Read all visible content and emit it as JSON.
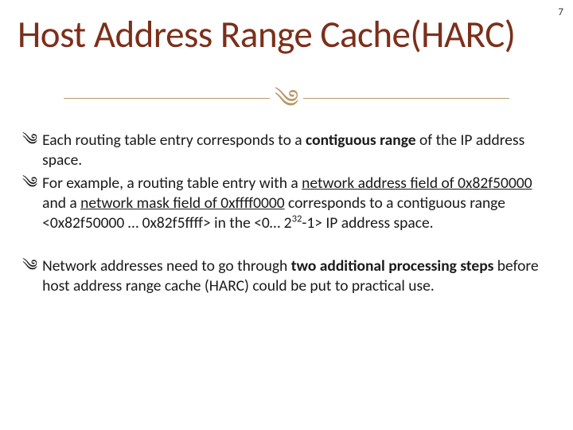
{
  "page_number": "7",
  "title": "Host Address Range Cache(HARC)",
  "flourish_glyph": "༄",
  "bullets": [
    {
      "pre": "Each routing table entry corresponds to a ",
      "bold": "contiguous range",
      "post": " of the IP address space."
    },
    {
      "pre": "For example, a routing table entry with a ",
      "u1": "network address field of 0x82f50000",
      "mid1": " and a ",
      "u2": "network mask field of 0xffff0000",
      "mid2": " corresponds to a contiguous range <0x82f50000 … 0x82f5ffff> in the <0… 2",
      "sup": "32",
      "post": "-1> IP address space."
    },
    {
      "pre": "Network addresses need to go through ",
      "bold": "two additional processing steps",
      "post": " before host address range cache (HARC) could be put to practical use."
    }
  ]
}
